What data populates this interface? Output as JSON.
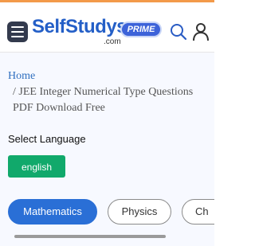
{
  "header": {
    "logo_main": "SelfStudys",
    "logo_domain": ".com",
    "logo_badge": "PRIME"
  },
  "icons": {
    "menu": "hamburger-menu-icon",
    "search": "search-icon",
    "user": "user-icon"
  },
  "breadcrumb": {
    "home": "Home",
    "current": "/ JEE Integer Numerical Type Questions PDF Download Free"
  },
  "language": {
    "label": "Select Language",
    "selected": "english"
  },
  "tabs": [
    {
      "label": "Mathematics",
      "active": true
    },
    {
      "label": "Physics",
      "active": false
    },
    {
      "label": "Ch",
      "active": false
    }
  ],
  "colors": {
    "accent_orange": "#f39a4a",
    "brand_blue": "#245fc7",
    "active_tab": "#2a6fd6",
    "language_button": "#11a96b"
  }
}
